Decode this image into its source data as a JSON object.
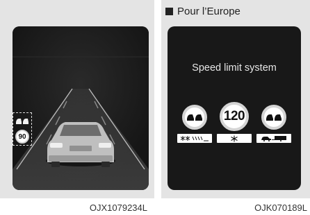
{
  "left_panel": {
    "caption": "OJX1079234L",
    "mini_sign": {
      "icon": "no-overtaking-icon",
      "speed": "90"
    }
  },
  "right_panel": {
    "region_label": "Pour l’Europe",
    "screen_title": "Speed limit system",
    "caption": "OJK070189L",
    "signs": [
      {
        "name": "no-overtaking-sign",
        "icon": "no-overtaking-icon",
        "plate": "snow-rain-plate"
      },
      {
        "name": "speed-limit-sign",
        "speed": "120",
        "plate": "snow-plate"
      },
      {
        "name": "no-overtaking-trailer-sign",
        "icon": "no-overtaking-icon",
        "plate": "car-trailer-plate"
      }
    ]
  }
}
